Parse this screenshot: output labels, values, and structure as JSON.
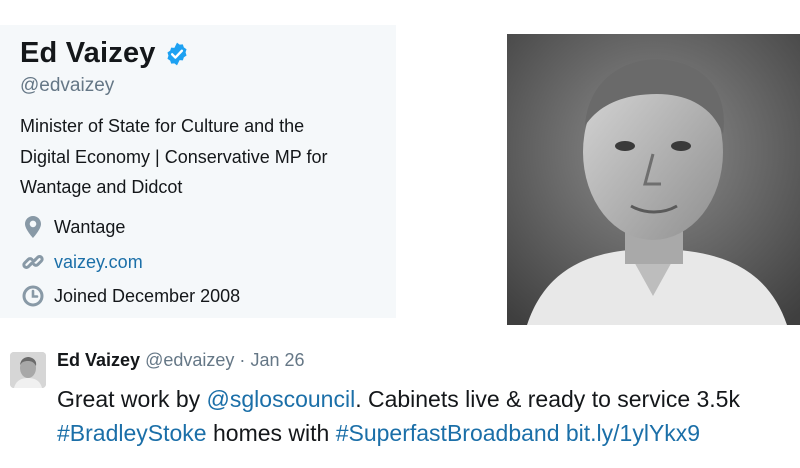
{
  "profile": {
    "name": "Ed Vaizey",
    "handle": "@edvaizey",
    "bio_lines": [
      "Minister of State for Culture and the",
      "Digital Economy | Conservative MP for",
      "Wantage and Didcot"
    ],
    "location": "Wantage",
    "website": "vaizey.com",
    "joined": "Joined December 2008",
    "icons": {
      "verified": "verified-badge-icon",
      "location": "map-pin-icon",
      "website": "link-icon",
      "joined": "clock-icon"
    }
  },
  "tweet": {
    "author_name": "Ed Vaizey",
    "author_handle": "@edvaizey",
    "separator": "·",
    "date": "Jan 26",
    "text_line1_prefix": "Great work by ",
    "mention": "@sgloscouncil",
    "text_line1_suffix": ". Cabinets live & ready to service 3.5k",
    "hashtag1": "#BradleyStoke",
    "text_line2_middle": " homes with ",
    "hashtag2": "#SuperfastBroadband",
    "short_link": "bit.ly/1ylYkx9"
  },
  "colors": {
    "card_background": "#f5f8fa",
    "link": "#1b6fa8",
    "secondary_text": "#657786",
    "verified": "#1da1f2"
  }
}
